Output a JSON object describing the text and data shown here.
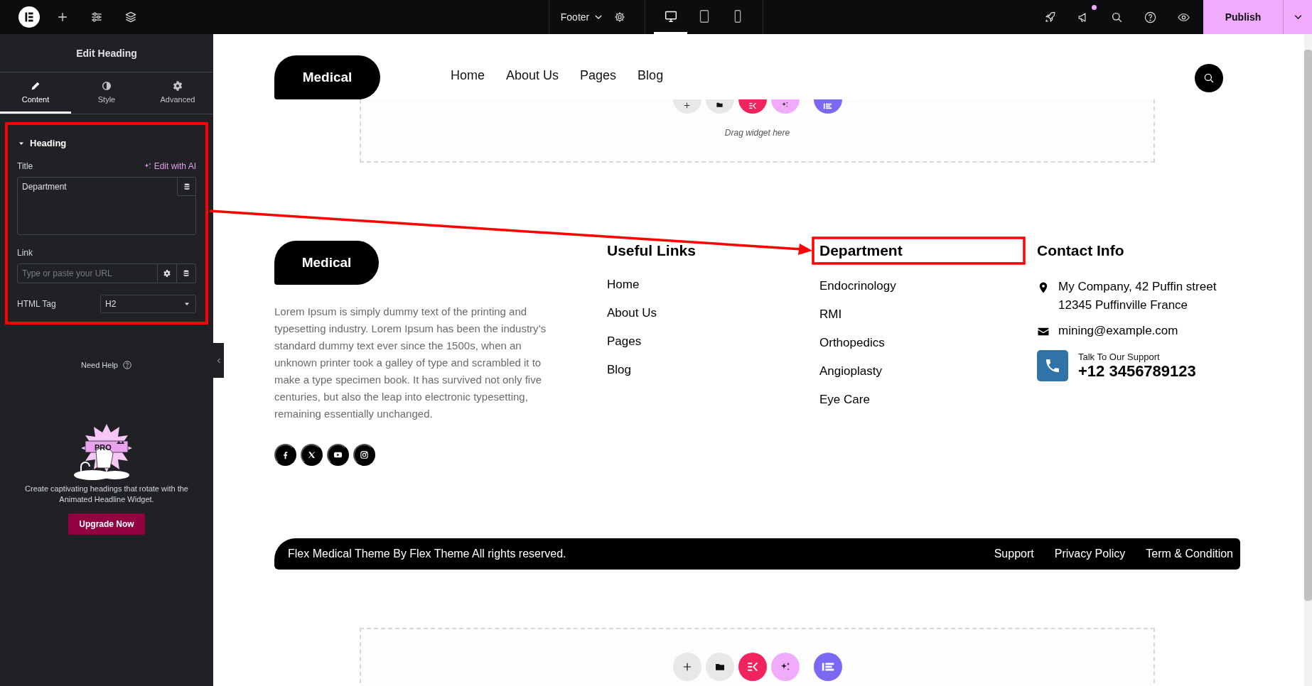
{
  "topbar": {
    "document": "Footer",
    "devices": [
      {
        "kind": "desktop",
        "selected": true
      },
      {
        "kind": "tablet",
        "selected": false
      },
      {
        "kind": "mobile",
        "selected": false
      }
    ],
    "notification": true,
    "publish": "Publish"
  },
  "panel": {
    "title": "Edit Heading",
    "tabs": [
      {
        "label": "Content",
        "kind": "pencil",
        "selected": true
      },
      {
        "label": "Style",
        "kind": "contrast",
        "selected": false
      },
      {
        "label": "Advanced",
        "kind": "gear",
        "selected": false
      }
    ],
    "section": {
      "title": "Heading",
      "expanded": true,
      "title_label": "Title",
      "ai_link": "Edit with AI",
      "title_value": "Department",
      "link_label": "Link",
      "link_placeholder": "Type or paste your URL",
      "tag_label": "HTML Tag",
      "tag_value": "H2"
    },
    "help": "Need Help",
    "promo": {
      "badge": "PRO",
      "text": "Create captivating headings that rotate with the Animated Headline Widget.",
      "button": "Upgrade Now"
    }
  },
  "header": {
    "logo": "Medical",
    "nav": [
      "Home",
      "About Us",
      "Pages",
      "Blog"
    ]
  },
  "dropzones": [
    {
      "hint": "Drag widget here"
    }
  ],
  "bottom_dropzone": true,
  "footer": {
    "logo": "Medical",
    "about": "Lorem Ipsum is simply dummy text of the printing and typesetting industry. Lorem Ipsum has been the industry’s standard dummy text ever since the 1500s, when an unknown printer took a galley of type and scrambled it to make a type specimen book. It has survived not only five centuries, but also the leap into electronic typesetting, remaining essentially unchanged.",
    "socials": [
      {
        "kind": "facebook"
      },
      {
        "kind": "x"
      },
      {
        "kind": "youtube"
      },
      {
        "kind": "instagram"
      }
    ],
    "columns": [
      {
        "title": "Useful Links",
        "selected": false,
        "links": [
          "Home",
          "About Us",
          "Pages",
          "Blog"
        ]
      },
      {
        "title": "Department",
        "selected": true,
        "links": [
          "Endocrinology",
          "RMI",
          "Orthopedics",
          "Angioplasty",
          "Eye Care"
        ]
      }
    ],
    "contact": {
      "title": "Contact Info",
      "address": "My Company, 42 Puffin street 12345 Puffinville France",
      "email": "mining@example.com",
      "support_label": "Talk To Our Support",
      "phone": "+12 3456789123"
    }
  },
  "bottom_bar": {
    "copyright": "Flex Medical Theme By Flex Theme All rights reserved.",
    "links": [
      "Support",
      "Privacy Policy",
      "Term & Condition"
    ]
  }
}
